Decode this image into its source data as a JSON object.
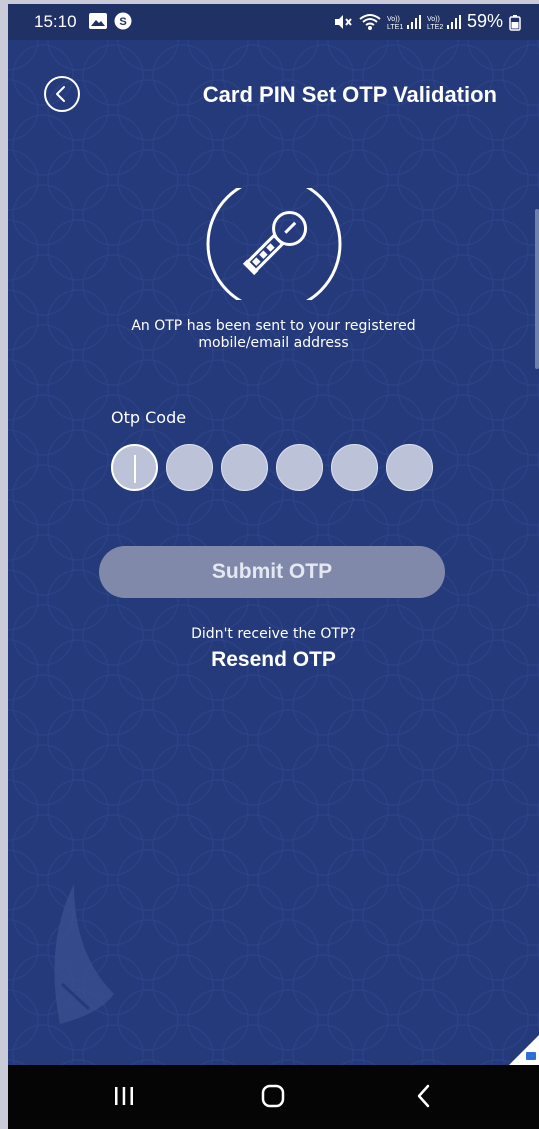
{
  "status_bar": {
    "time": "15:10",
    "battery_percent": "59%",
    "left_icons": [
      "gallery-icon",
      "s-app-icon"
    ],
    "right_icons": [
      "mute-icon",
      "wifi-icon",
      "lte1-signal-icon",
      "lte2-signal-icon",
      "battery-icon"
    ]
  },
  "header": {
    "back_icon": "chevron-left-icon",
    "title": "Card PIN Set OTP Validation"
  },
  "key_icon": "key-icon",
  "info": {
    "line1": "An OTP has been sent to your registered",
    "line2": "mobile/email address"
  },
  "otp": {
    "label": "Otp Code",
    "digits": [
      "",
      "",
      "",
      "",
      "",
      ""
    ]
  },
  "submit": {
    "label": "Submit OTP"
  },
  "resend": {
    "hint": "Didn't receive the OTP?",
    "link": "Resend OTP"
  },
  "nav": {
    "recents_icon": "recents-icon",
    "home_icon": "home-icon",
    "back_icon": "back-icon"
  },
  "colors": {
    "background": "#253a7a",
    "status_bar": "#1f3165",
    "button_disabled": "#8089a9",
    "otp_box": "#bcc3d9",
    "text": "#ffffff"
  }
}
